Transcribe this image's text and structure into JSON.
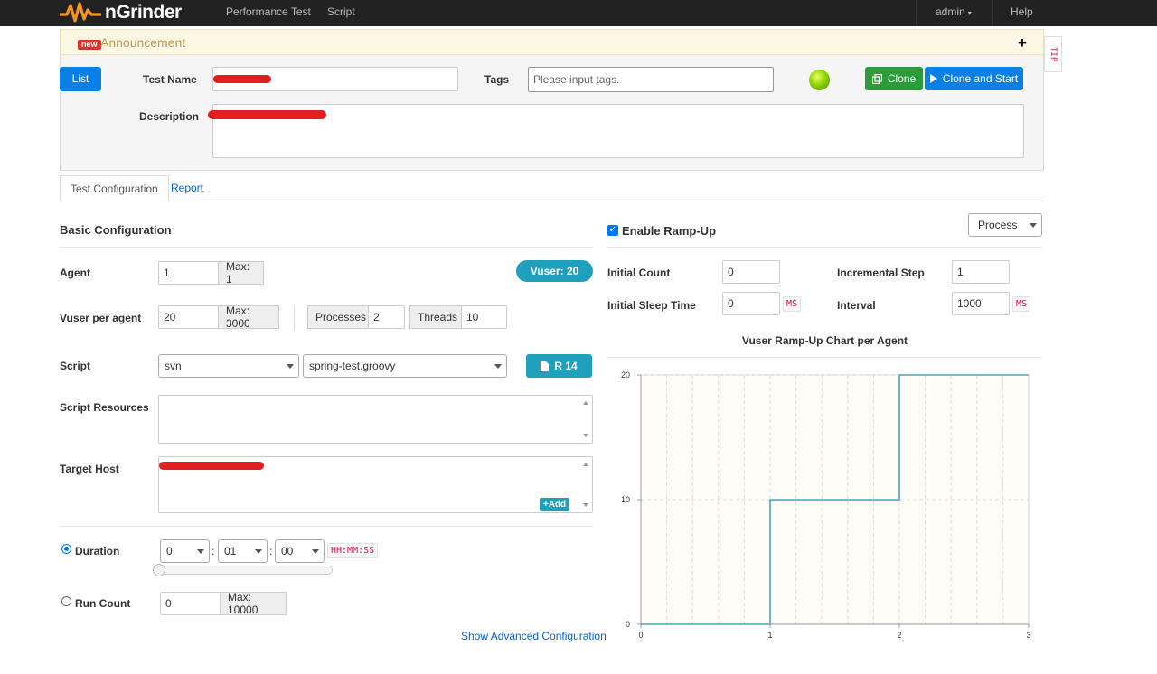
{
  "app": {
    "name": "nGrinder"
  },
  "nav": {
    "performance_test": "Performance Test",
    "script": "Script",
    "user": "admin",
    "help": "Help"
  },
  "announcement": {
    "badge": "new",
    "text": "Announcement",
    "toggle": "+"
  },
  "tip": "TIP",
  "header": {
    "list_label": "List",
    "test_name_label": "Test Name",
    "tags_label": "Tags",
    "tags_placeholder": "Please input tags.",
    "description_label": "Description",
    "clone_label": "Clone",
    "clone_start_label": "Clone and Start",
    "status_color": "#8fd400"
  },
  "tabs": [
    {
      "label": "Test Configuration"
    },
    {
      "label": "Report"
    }
  ],
  "basic": {
    "title": "Basic Configuration",
    "agent_label": "Agent",
    "agent_value": "1",
    "agent_max": "Max: 1",
    "vuser_badge": "Vuser: 20",
    "vuser_label": "Vuser per agent",
    "vuser_value": "20",
    "vuser_max": "Max: 3000",
    "processes_label": "Processes",
    "processes_value": "2",
    "threads_label": "Threads",
    "threads_value": "10",
    "script_label": "Script",
    "script_repo": "svn",
    "script_file": "spring-test.groovy",
    "revision_label": "R 14",
    "resources_label": "Script Resources",
    "target_host_label": "Target Host",
    "add_label": "Add",
    "duration_label": "Duration",
    "duration_h": "0",
    "duration_m": "01",
    "duration_s": "00",
    "duration_unit": "HH:MM:SS",
    "run_count_label": "Run Count",
    "run_count_value": "0",
    "run_count_max": "Max: 10000",
    "advanced_link": "Show Advanced Configuration"
  },
  "rampup": {
    "enable_label": "Enable Ramp-Up",
    "type": "Process",
    "initial_count_label": "Initial Count",
    "initial_count": "0",
    "incremental_step_label": "Incremental Step",
    "incremental_step": "1",
    "initial_sleep_label": "Initial Sleep Time",
    "initial_sleep": "0",
    "initial_sleep_unit": "MS",
    "interval_label": "Interval",
    "interval": "1000",
    "interval_unit": "MS"
  },
  "chart_data": {
    "type": "line",
    "title": "Vuser Ramp-Up Chart per Agent",
    "x": [
      0,
      1,
      1,
      2,
      2,
      3
    ],
    "y": [
      0,
      0,
      10,
      10,
      20,
      20
    ],
    "xlim": [
      0,
      3
    ],
    "ylim": [
      0,
      20
    ],
    "xticks": [
      "0",
      "1",
      "2",
      "3"
    ],
    "yticks": [
      "0",
      "10",
      "20"
    ],
    "line_color": "#4ba3c3",
    "background": "#fffdf5",
    "grid": true
  }
}
